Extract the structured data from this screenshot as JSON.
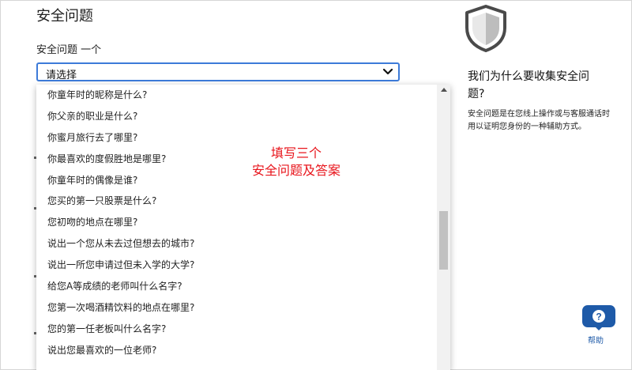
{
  "section": {
    "heading": "安全问题",
    "question_label": "安全问题 一个",
    "select_value": "请选择"
  },
  "dropdown": {
    "options": [
      "你童年时的昵称是什么?",
      "你父亲的职业是什么?",
      "你蜜月旅行去了哪里?",
      "你最喜欢的度假胜地是哪里?",
      "你童年时的偶像是谁?",
      "您买的第一只股票是什么?",
      "您初吻的地点在哪里?",
      "说出一个您从未去过但想去的城市?",
      "说出一所您申请过但未入学的大学?",
      "给您A等成绩的老师叫什么名字?",
      "您第一次喝酒精饮料的地点在哪里?",
      "您的第一任老板叫什么名字?",
      "说出您最喜欢的一位老师?"
    ],
    "scroll_position": 0.5
  },
  "annotation": {
    "line1": "填写三个",
    "line2": "安全问题及答案"
  },
  "sidebar": {
    "title": "我们为什么要收集安全问题?",
    "body": "安全问题是在您线上操作或与客服通话时用以证明您身份的一种辅助方式。"
  },
  "help": {
    "label": "帮助"
  },
  "colors": {
    "focus_border": "#3d7bd9",
    "annotation": "#e8141b",
    "help_blue": "#1e5aa8"
  }
}
